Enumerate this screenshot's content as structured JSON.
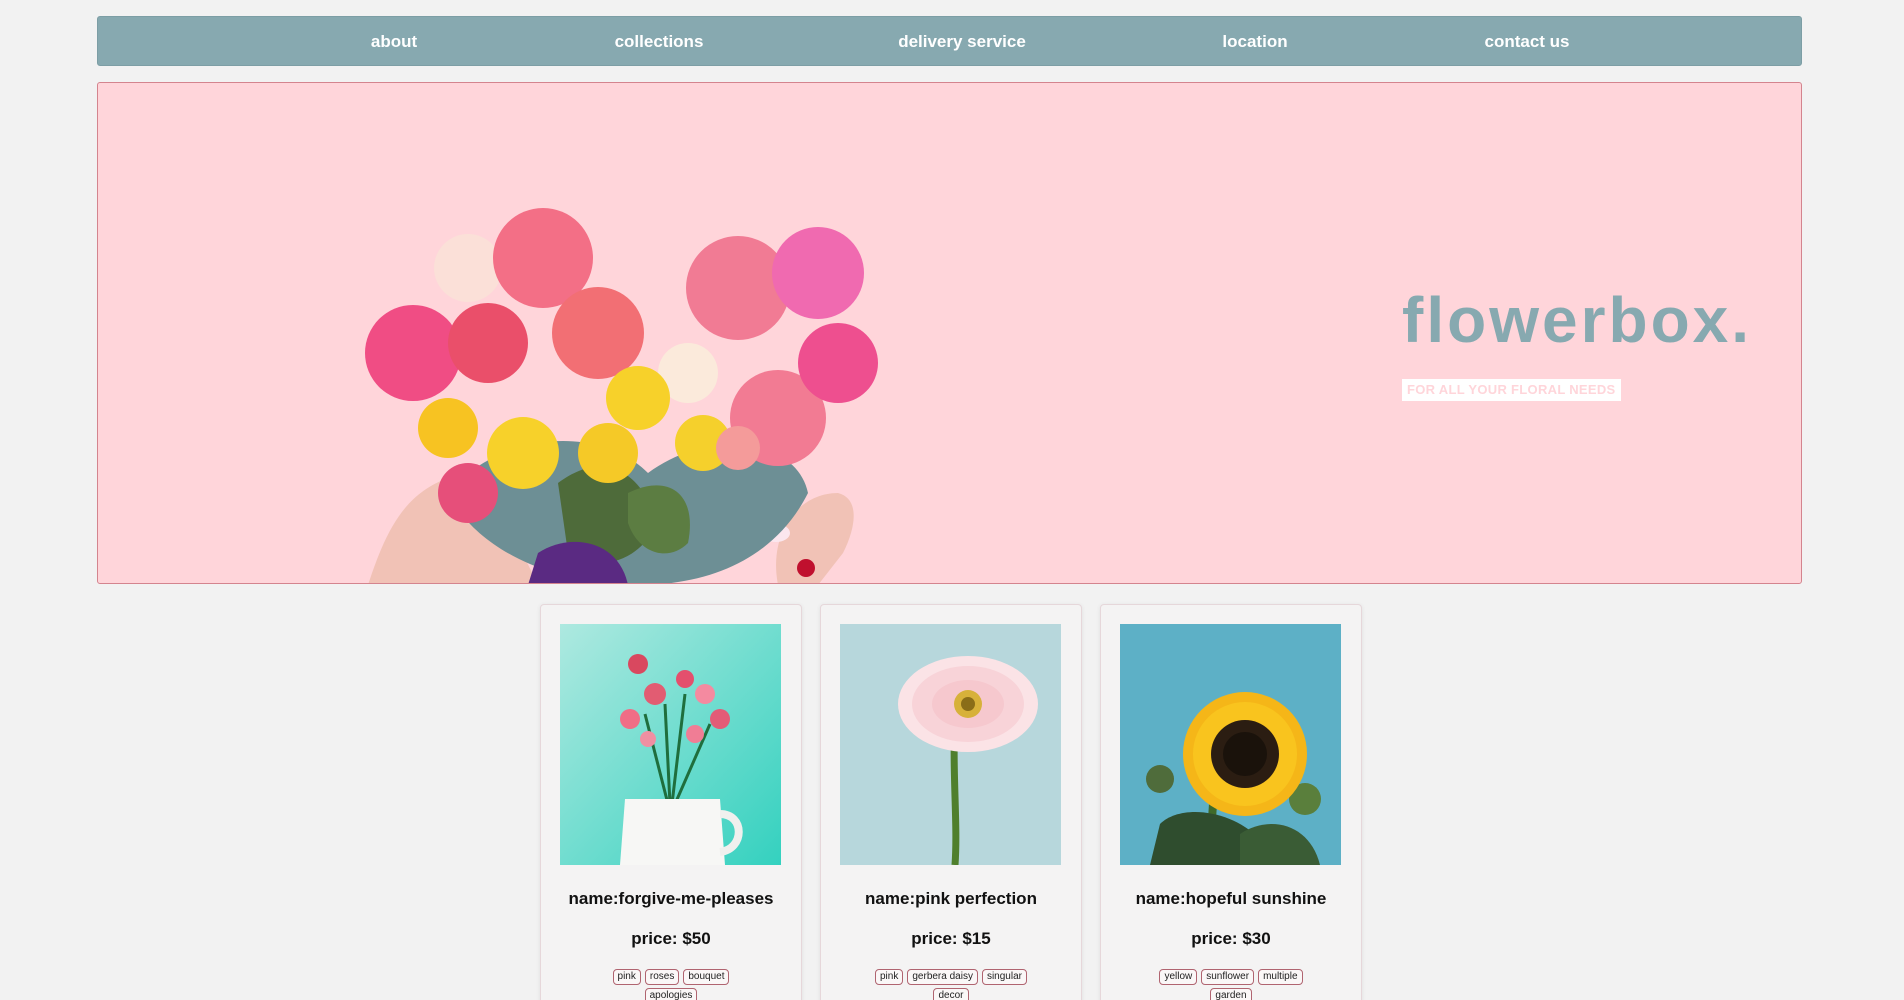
{
  "nav": {
    "items": [
      {
        "label": "about"
      },
      {
        "label": "collections"
      },
      {
        "label": "delivery service"
      },
      {
        "label": "location"
      },
      {
        "label": "contact us"
      }
    ]
  },
  "hero": {
    "title": "flowerbox.",
    "tagline": "FOR ALL YOUR FLORAL NEEDS",
    "image_icon": "heart-bouquet-image"
  },
  "products": [
    {
      "name": "name:forgive-me-pleases",
      "price": "price: $50",
      "tags": [
        "pink",
        "roses",
        "bouquet",
        "apologies"
      ],
      "image_icon": "pink-roses-in-pitcher-image"
    },
    {
      "name": "name:pink perfection",
      "price": "price: $15",
      "tags": [
        "pink",
        "gerbera daisy",
        "singular",
        "decor"
      ],
      "image_icon": "pink-gerbera-image"
    },
    {
      "name": "name:hopeful sunshine",
      "price": "price: $30",
      "tags": [
        "yellow",
        "sunflower",
        "multiple",
        "garden"
      ],
      "image_icon": "sunflower-image"
    }
  ],
  "colors": {
    "nav_bg": "#87a9b0",
    "hero_bg": "#ffd5da",
    "page_bg": "#f2f2f2"
  }
}
